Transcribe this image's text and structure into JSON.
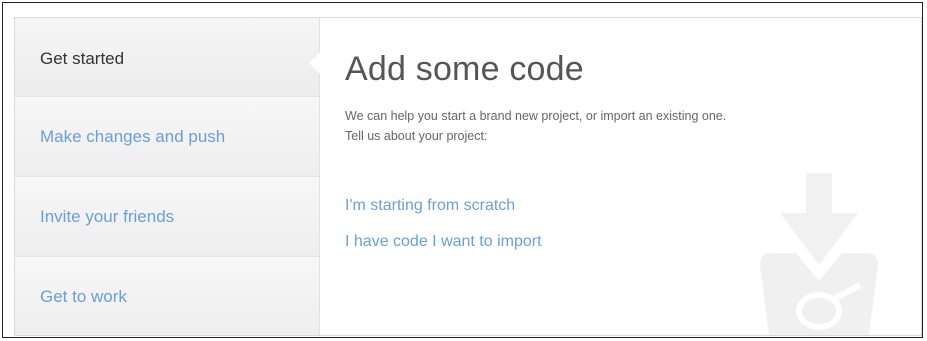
{
  "sidebar": {
    "steps": [
      {
        "label": "Get started",
        "active": true
      },
      {
        "label": "Make changes and push",
        "active": false
      },
      {
        "label": "Invite your friends",
        "active": false
      },
      {
        "label": "Get to work",
        "active": false
      }
    ]
  },
  "main": {
    "title": "Add some code",
    "description_line1": "We can help you start a brand new project, or import an existing one.",
    "description_line2": "Tell us about your project:",
    "options": {
      "scratch": "I'm starting from scratch",
      "import": "I have code I want to import"
    },
    "watermark_icon": "bucket-download-icon"
  },
  "colors": {
    "link": "#6a9fd8",
    "active_text": "#333333",
    "title": "#555555",
    "sidebar_bg": "#f3f3f3"
  }
}
